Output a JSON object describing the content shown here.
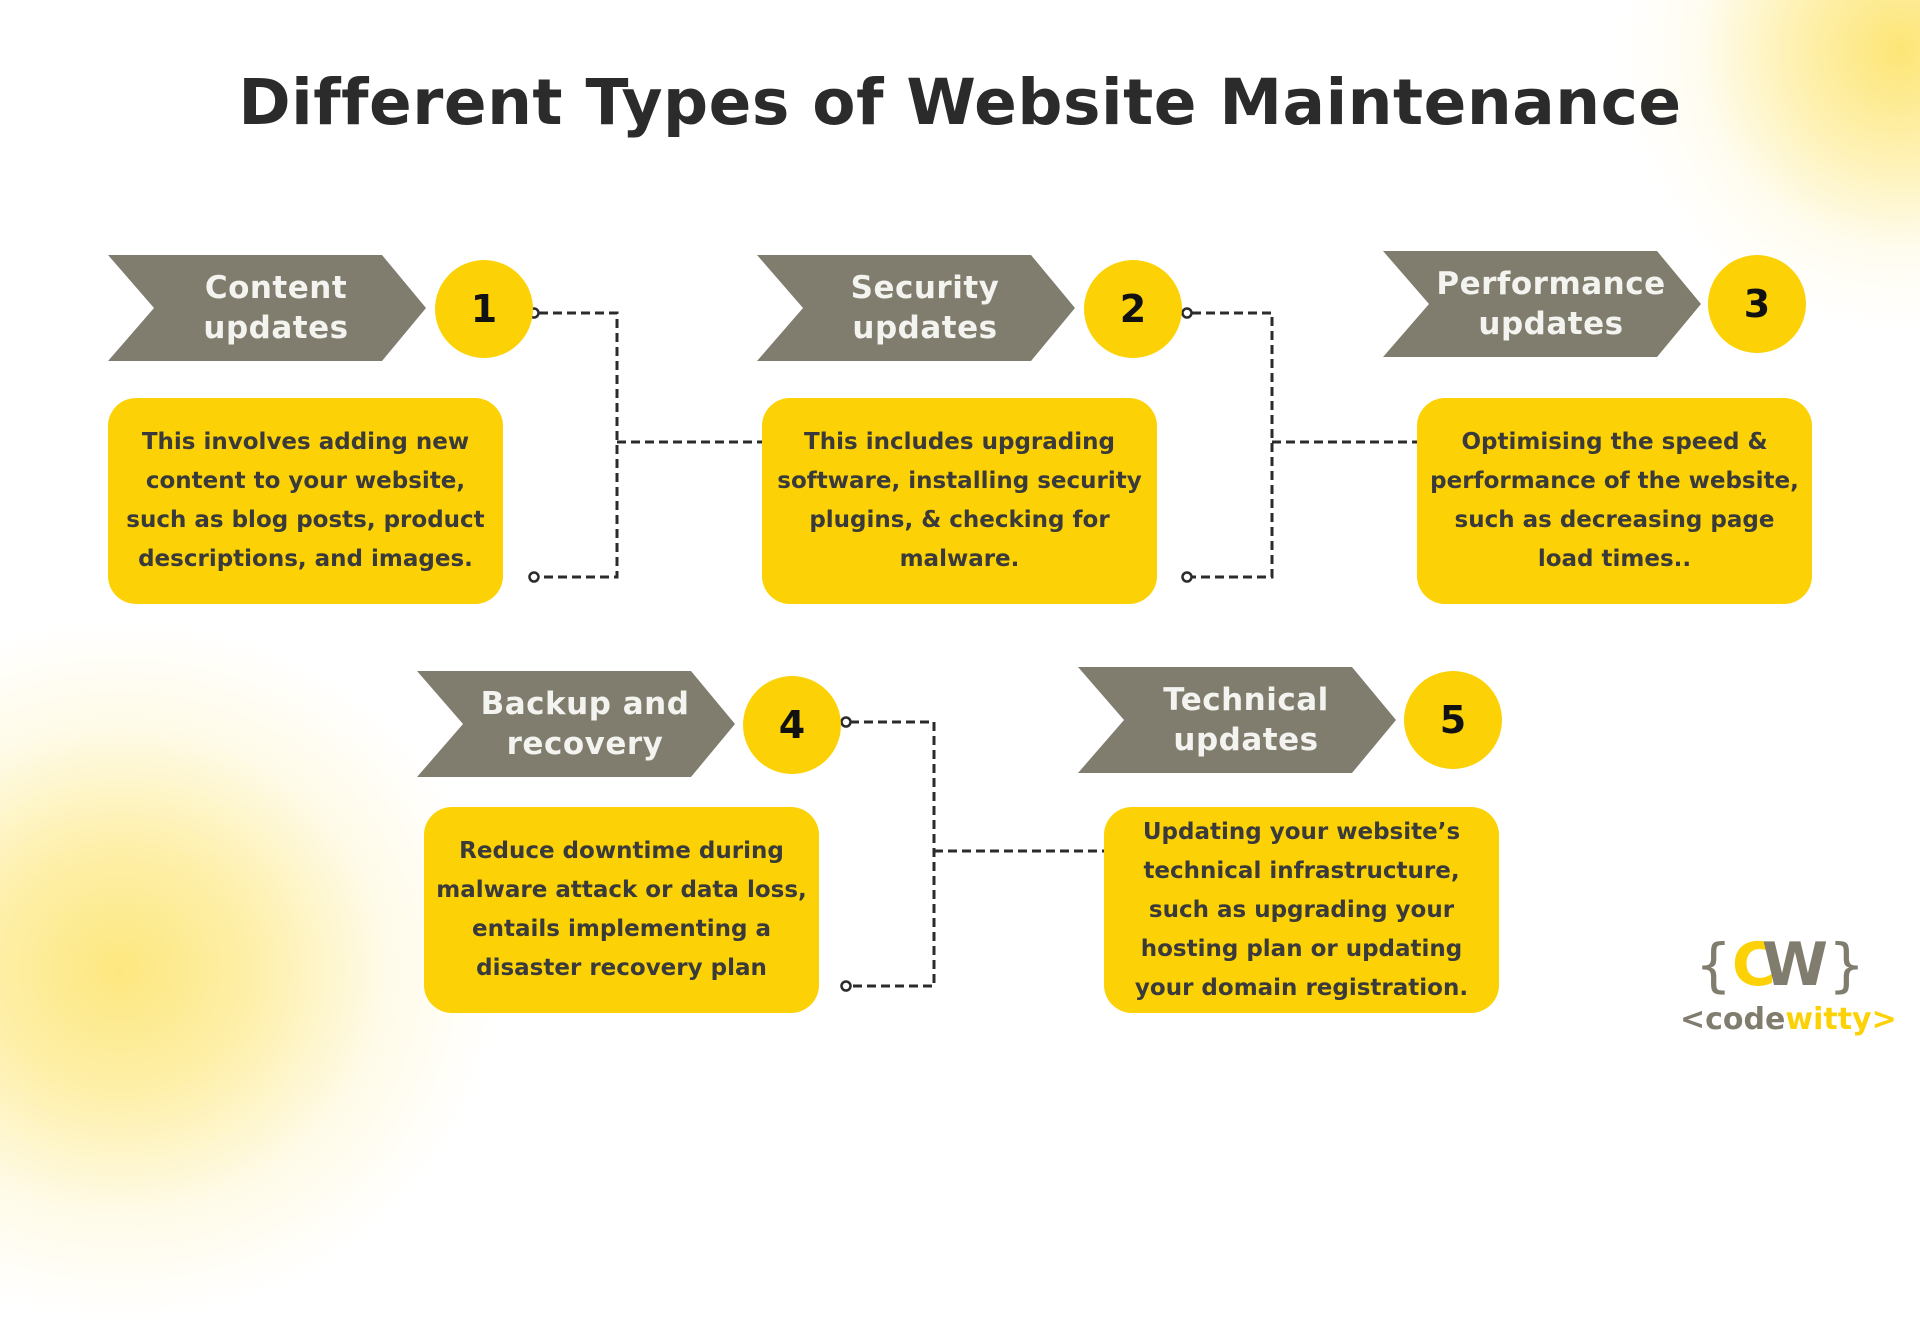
{
  "title": "Different Types of Website Maintenance",
  "colors": {
    "banner": "#817d6e",
    "accent_yellow": "#fcd206",
    "title_text": "#2b2b2b",
    "body_text": "#3a3a3a",
    "banner_text": "#f3f3ef",
    "connector": "#2b2b2b"
  },
  "steps": [
    {
      "number": "1",
      "label_line1": "Content",
      "label_line2": "updates",
      "description": "This involves adding new content to your website, such as blog posts, product descriptions, and images."
    },
    {
      "number": "2",
      "label_line1": "Security",
      "label_line2": "updates",
      "description": "This includes upgrading software, installing security plugins, & checking for malware."
    },
    {
      "number": "3",
      "label_line1": "Performance",
      "label_line2": "updates",
      "description": "Optimising the speed & performance of the website, such as decreasing page load times.."
    },
    {
      "number": "4",
      "label_line1": "Backup and",
      "label_line2": "recovery",
      "description": "Reduce downtime during malware attack or data loss, entails implementing a disaster recovery plan"
    },
    {
      "number": "5",
      "label_line1": "Technical",
      "label_line2": "updates",
      "description": "Updating your website’s technical infrastructure, such as upgrading your hosting plan or updating your domain registration."
    }
  ],
  "logo": {
    "brace_open": "{",
    "mark_c": "C",
    "mark_w": "W",
    "brace_close": "}",
    "word_prefix": "<code",
    "word_suffix": "witty>"
  }
}
